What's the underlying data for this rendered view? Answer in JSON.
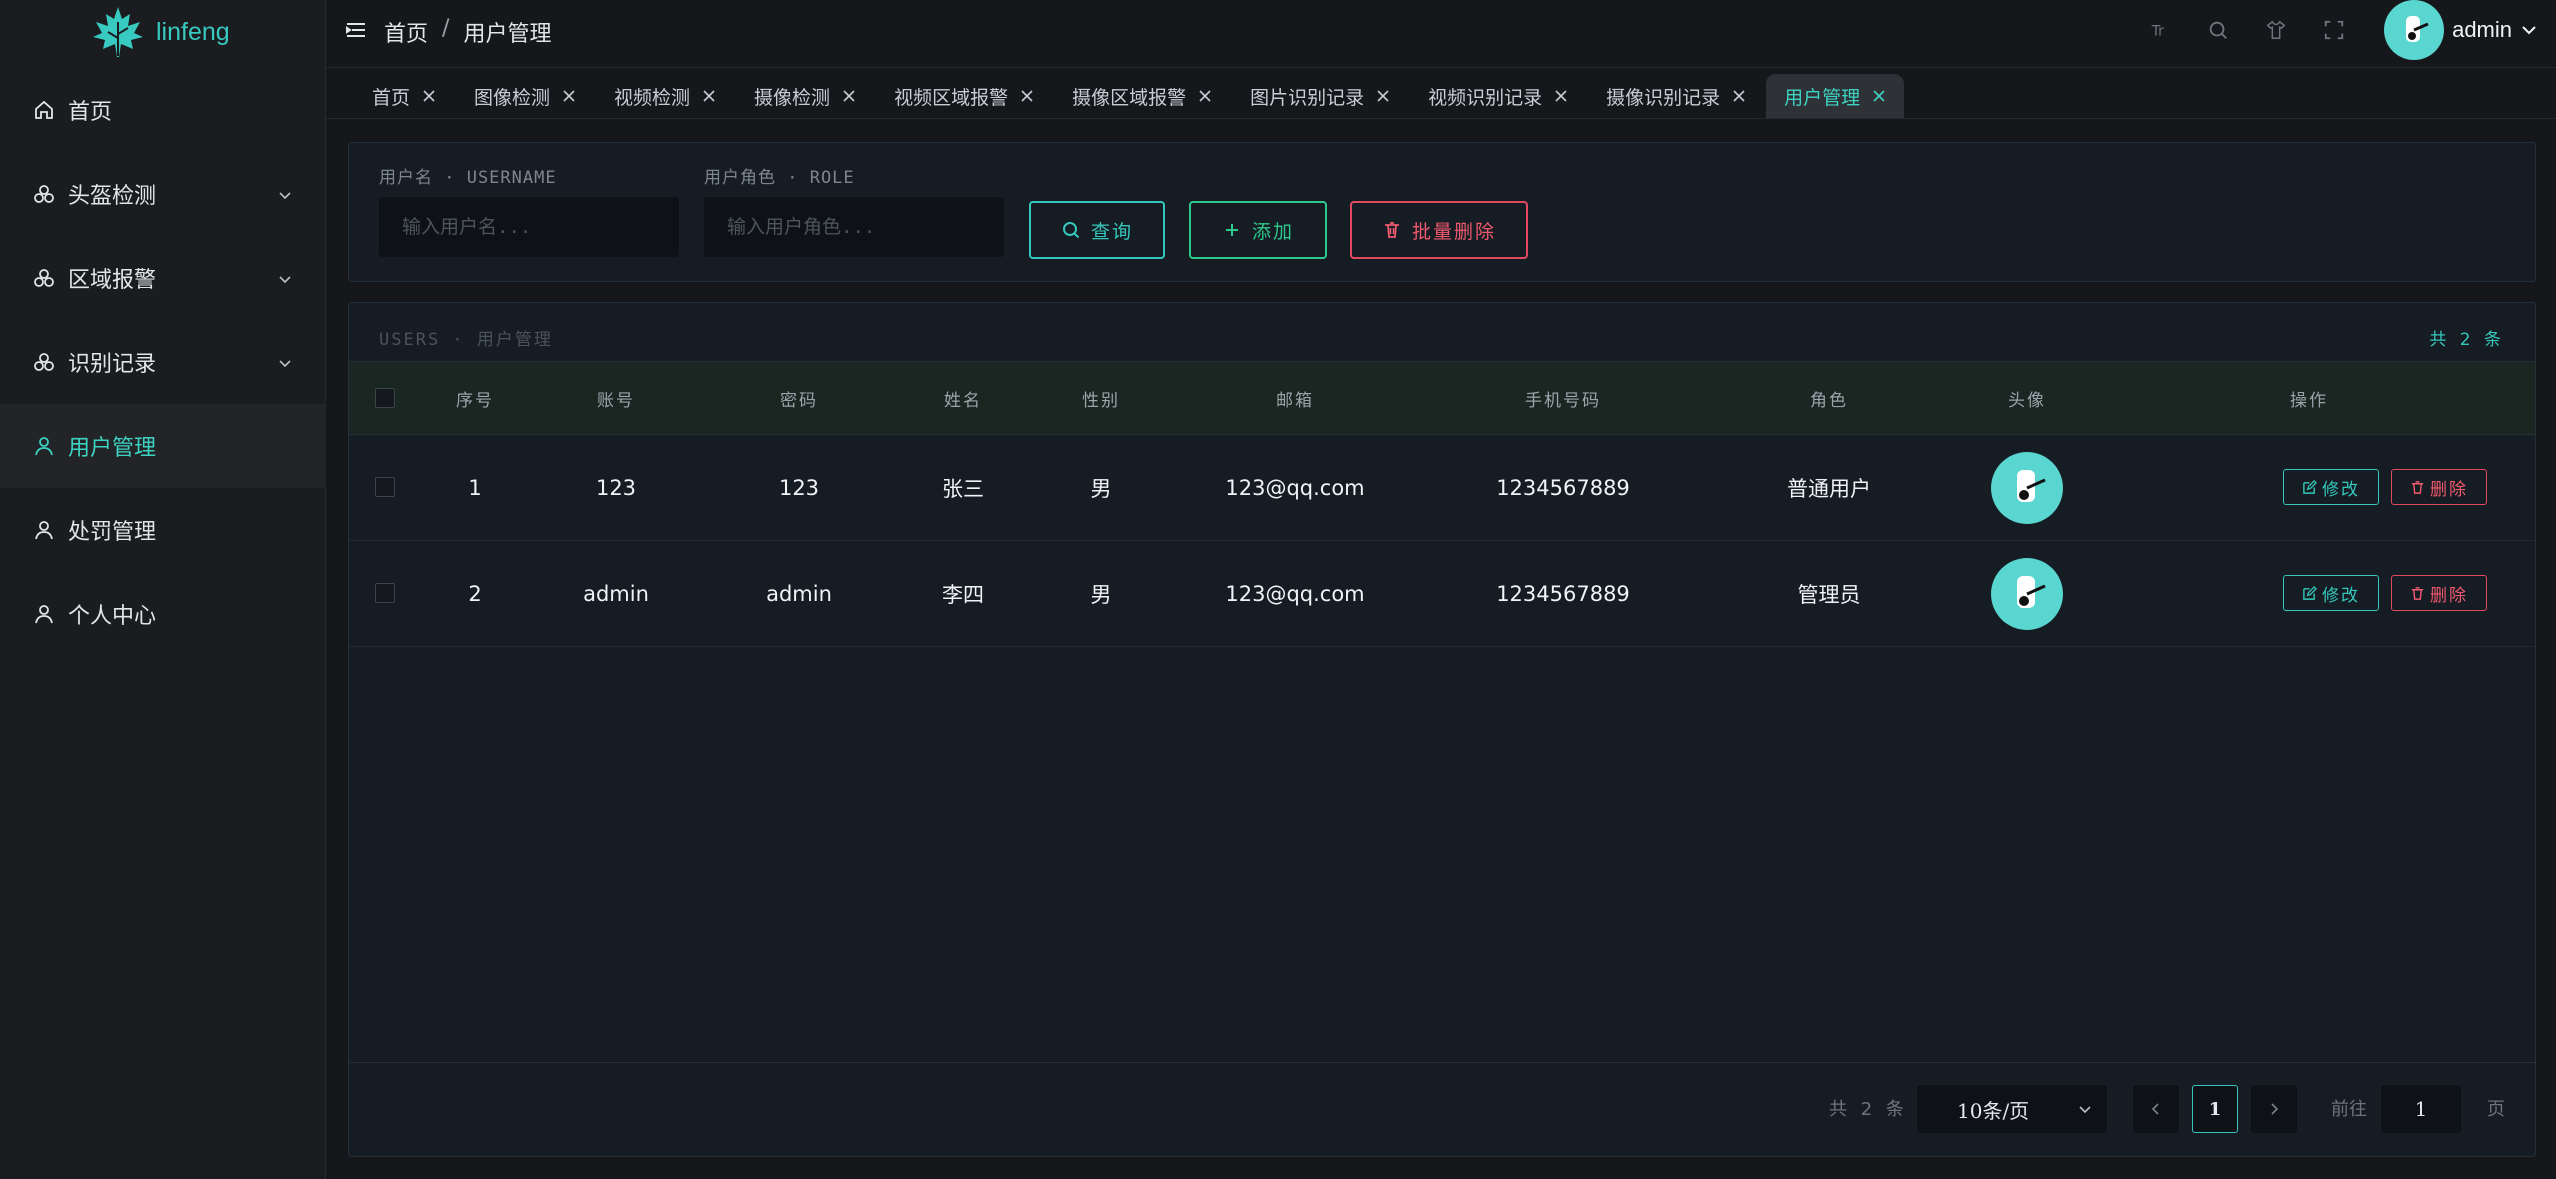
{
  "app": {
    "name": "linfeng",
    "accent": "#3dd3c3"
  },
  "sidebar": {
    "items": [
      {
        "label": "首页",
        "icon": "home-icon",
        "expandable": false
      },
      {
        "label": "头盔检测",
        "icon": "modules-icon",
        "expandable": true
      },
      {
        "label": "区域报警",
        "icon": "modules-icon",
        "expandable": true
      },
      {
        "label": "识别记录",
        "icon": "modules-icon",
        "expandable": true
      },
      {
        "label": "用户管理",
        "icon": "user-icon",
        "expandable": false,
        "active": true
      },
      {
        "label": "处罚管理",
        "icon": "user-icon",
        "expandable": false
      },
      {
        "label": "个人中心",
        "icon": "user-icon",
        "expandable": false
      }
    ]
  },
  "header": {
    "breadcrumb": [
      "首页",
      "用户管理"
    ],
    "separator": "/",
    "tools": [
      "font-size-icon",
      "search-icon",
      "theme-icon",
      "fullscreen-icon"
    ],
    "username": "admin"
  },
  "tabs": [
    {
      "label": "首页"
    },
    {
      "label": "图像检测"
    },
    {
      "label": "视频检测"
    },
    {
      "label": "摄像检测"
    },
    {
      "label": "视频区域报警"
    },
    {
      "label": "摄像区域报警"
    },
    {
      "label": "图片识别记录"
    },
    {
      "label": "视频识别记录"
    },
    {
      "label": "摄像识别记录"
    },
    {
      "label": "用户管理",
      "active": true
    }
  ],
  "filter": {
    "username_label": "用户名 · USERNAME",
    "username_placeholder": "输入用户名...",
    "role_label": "用户角色 · ROLE",
    "role_placeholder": "输入用户角色...",
    "query_button": "查询",
    "add_button": "添加",
    "batch_delete_button": "批量删除"
  },
  "table": {
    "title": "USERS · 用户管理",
    "count_text": "共 2 条",
    "columns": [
      "序号",
      "账号",
      "密码",
      "姓名",
      "性别",
      "邮箱",
      "手机号码",
      "角色",
      "头像",
      "操作"
    ],
    "rows": [
      {
        "index": "1",
        "account": "123",
        "password": "123",
        "name": "张三",
        "gender": "男",
        "email": "123@qq.com",
        "phone": "1234567889",
        "role": "普通用户"
      },
      {
        "index": "2",
        "account": "admin",
        "password": "admin",
        "name": "李四",
        "gender": "男",
        "email": "123@qq.com",
        "phone": "1234567889",
        "role": "管理员"
      }
    ],
    "edit_label": "修改",
    "delete_label": "删除"
  },
  "pagination": {
    "total_text": "共 2 条",
    "page_size": "10条/页",
    "current_page": "1",
    "goto_label": "前往",
    "goto_value": "1",
    "goto_unit": "页"
  },
  "colors": {
    "danger": "#e2495f",
    "success": "#2fc98c",
    "teal": "#35c7bb"
  }
}
